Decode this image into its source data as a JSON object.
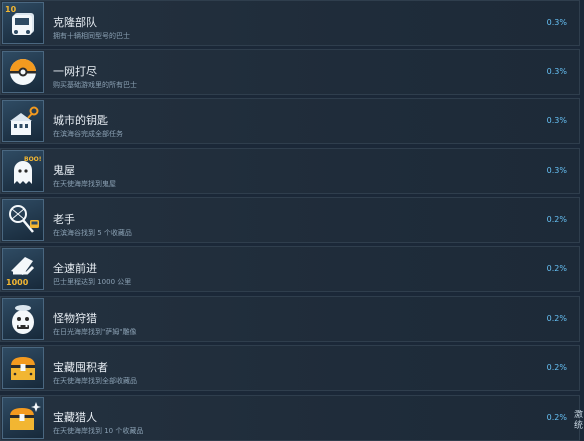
{
  "achievements": [
    {
      "title": "克隆部队",
      "desc": "拥有十辆相同型号的巴士",
      "percent": "0.3%",
      "icon": "bus-fleet-icon",
      "badge": "10"
    },
    {
      "title": "一网打尽",
      "desc": "购买基础游戏里的所有巴士",
      "percent": "0.3%",
      "icon": "ball-collection-icon"
    },
    {
      "title": "城市的钥匙",
      "desc": "在滨海谷完成全部任务",
      "percent": "0.3%",
      "icon": "city-key-icon"
    },
    {
      "title": "鬼屋",
      "desc": "在天使海岸找到鬼屋",
      "percent": "0.3%",
      "icon": "ghost-icon",
      "badge": "BOO!"
    },
    {
      "title": "老手",
      "desc": "在滨海谷找到 5 个收藏品",
      "percent": "0.2%",
      "icon": "net-bus-icon"
    },
    {
      "title": "全速前进",
      "desc": "巴士里程达到 1000 公里",
      "percent": "0.2%",
      "icon": "speed-1000-icon",
      "badge": "1000"
    },
    {
      "title": "怪物狩猎",
      "desc": "在日光海岸找到\"萨姆\"雕像",
      "percent": "0.2%",
      "icon": "monster-icon"
    },
    {
      "title": "宝藏囤积者",
      "desc": "在天使海岸找到全部收藏品",
      "percent": "0.2%",
      "icon": "treasure-chest-icon"
    },
    {
      "title": "宝藏猎人",
      "desc": "在天使海岸找到 10 个收藏品",
      "percent": "0.2%",
      "icon": "treasure-hunter-icon"
    }
  ],
  "edge_text": "激 统"
}
